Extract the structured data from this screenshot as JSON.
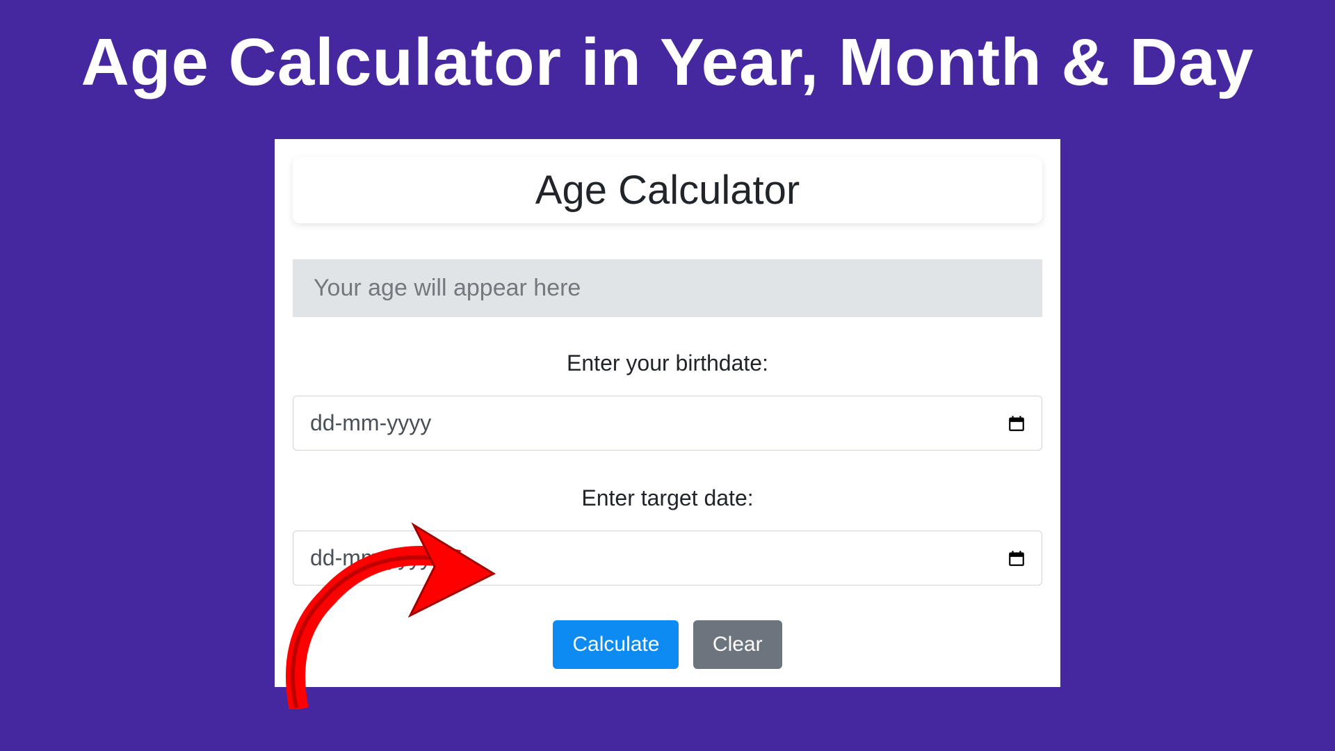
{
  "page": {
    "title": "Age Calculator in Year, Month & Day"
  },
  "card": {
    "header_title": "Age Calculator",
    "result_placeholder": "Your age will appear here",
    "birthdate_label": "Enter your birthdate:",
    "birthdate_placeholder": "dd-mm-yyyy",
    "target_label": "Enter target date:",
    "target_placeholder": "dd-mm-yyyy",
    "calculate_label": "Calculate",
    "clear_label": "Clear"
  }
}
